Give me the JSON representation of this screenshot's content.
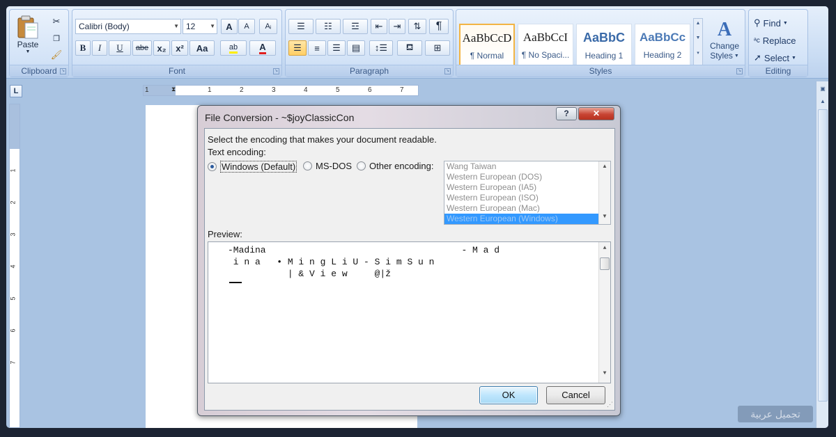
{
  "ribbon": {
    "clipboard": {
      "label": "Clipboard",
      "paste": "Paste"
    },
    "font": {
      "label": "Font",
      "family": "Calibri (Body)",
      "size": "12",
      "bold": "B",
      "italic": "I",
      "underline": "U",
      "strike": "abe",
      "subscript": "x₂",
      "superscript": "x²",
      "case": "Aa",
      "grow": "A",
      "shrink": "A",
      "highlight": "ab",
      "color": "A"
    },
    "paragraph": {
      "label": "Paragraph",
      "pilcrow": "¶"
    },
    "styles": {
      "label": "Styles",
      "tiles": [
        {
          "preview": "AaBbCcD",
          "name": "¶ Normal"
        },
        {
          "preview": "AaBbCcI",
          "name": "¶ No Spaci..."
        },
        {
          "preview": "AaBbC",
          "name": "Heading 1"
        },
        {
          "preview": "AaBbCc",
          "name": "Heading 2"
        }
      ],
      "change_line1": "Change",
      "change_line2": "Styles"
    },
    "editing": {
      "label": "Editing",
      "find": "Find",
      "replace": "Replace",
      "select": "Select"
    }
  },
  "ruler": {
    "h_numbers": [
      "1",
      "1",
      "2",
      "3",
      "4",
      "5",
      "6",
      "7"
    ],
    "v_numbers": [
      "1",
      "2",
      "3",
      "4",
      "5",
      "6",
      "7"
    ],
    "tab_selector": "L"
  },
  "dialog": {
    "title": "File Conversion - ~$joyClassicCon",
    "instruction": "Select the encoding that makes your document readable.",
    "text_encoding_label": "Text encoding:",
    "options": {
      "windows": "Windows (Default)",
      "msdos": "MS-DOS",
      "other": "Other encoding:"
    },
    "encodings": [
      "Wang Taiwan",
      "Western European (DOS)",
      "Western European (IA5)",
      "Western European (ISO)",
      "Western European (Mac)",
      "Western European (Windows)"
    ],
    "preview_label": "Preview:",
    "preview_lines": [
      "-Madina                                    - M a d",
      " i n a   • M i n g L i U - S i m S u n",
      "           | & V i e w     @|ž"
    ],
    "ok": "OK",
    "cancel": "Cancel",
    "help": "?",
    "close": "✕"
  },
  "watermark": "تجميل عربية",
  "colors": {
    "ribbon_bg": "#d3e3f7",
    "workspace_bg": "#a9c3e2",
    "selection_blue": "#3399ff",
    "close_red": "#c74433"
  }
}
